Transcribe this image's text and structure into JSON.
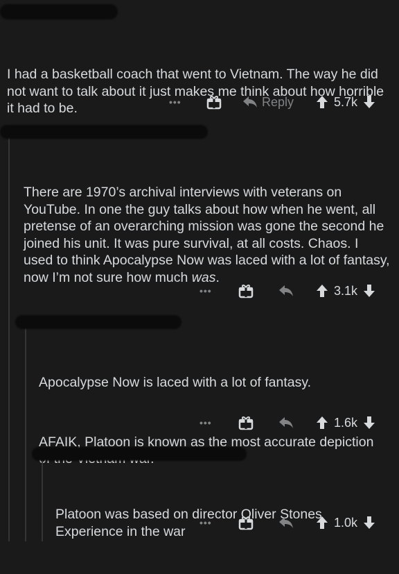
{
  "comments": [
    {
      "author": "",
      "body": [
        "I had a basketball coach that went to Vietnam. The way he did not want to talk about it just makes me think about how horrible it had to be."
      ],
      "reply_label": "Reply",
      "score": "5.7k"
    },
    {
      "author": "",
      "body_parts": [
        "There are 1970’s archival interviews with veterans on YouTube. In one the guy talks about how when he went, all pretense of an overarching mission was gone the second he joined his unit. It was pure survival, at all costs. Chaos. I used to think Apocalypse Now was laced with a lot of fantasy, now I’m not sure how much ",
        "was",
        "."
      ],
      "score": "3.1k"
    },
    {
      "author": "",
      "body": [
        "Apocalypse Now is laced with a lot of fantasy.",
        "AFAIK, Platoon is known as the most accurate depiction of the Vietnam war."
      ],
      "score": "1.6k"
    },
    {
      "author": "",
      "body": [
        "Platoon was based on director Oliver Stones Experience in the war"
      ],
      "score": "1.0k"
    }
  ],
  "icons": {
    "more": "more-options-icon",
    "gift": "gift-icon",
    "reply": "reply-icon",
    "upvote": "upvote-icon",
    "downvote": "downvote-icon"
  },
  "colors": {
    "background": "#1a1a1b",
    "text": "#d7dadc",
    "muted": "#818384",
    "thread_line": "#343536"
  }
}
